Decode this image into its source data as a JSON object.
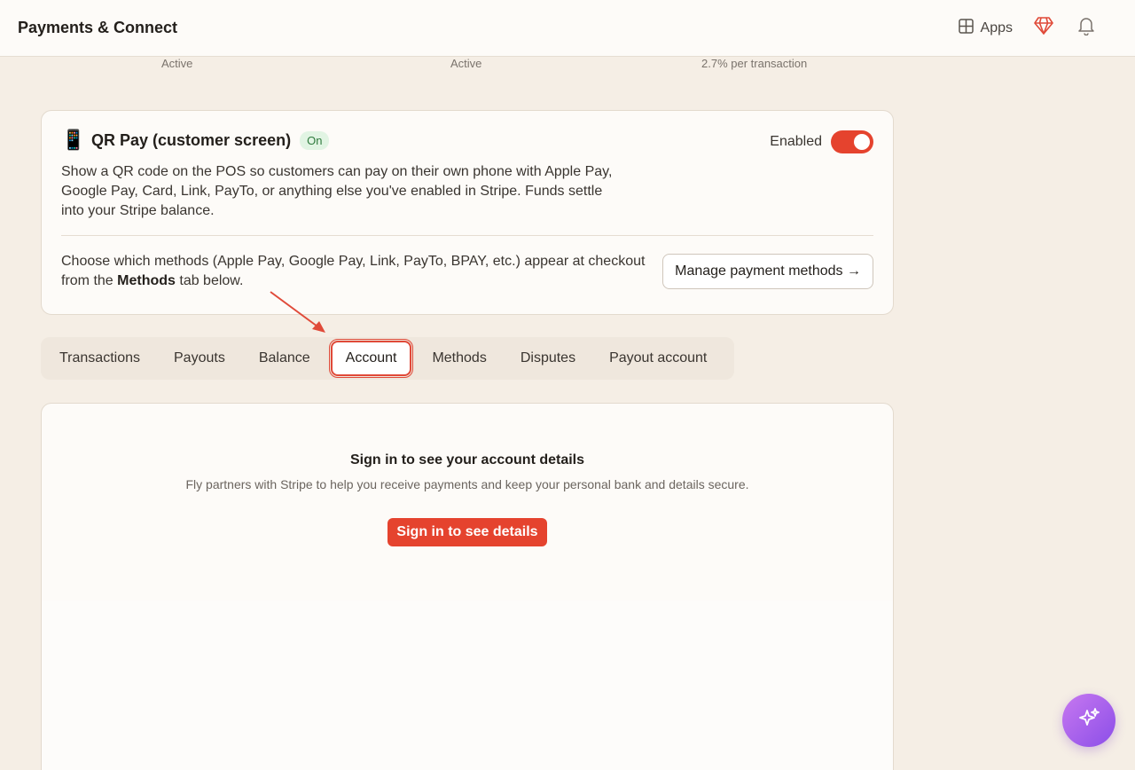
{
  "header": {
    "title": "Payments & Connect",
    "apps_label": "Apps"
  },
  "status_row": {
    "col1": "Active",
    "col2": "Active",
    "col3": "2.7% per transaction"
  },
  "qr_card": {
    "icon": "📱",
    "title": "QR Pay (customer screen)",
    "badge": "On",
    "enabled_label": "Enabled",
    "enabled": true,
    "description": "Show a QR code on the POS so customers can pay on their own phone with Apple Pay, Google Pay, Card, Link, PayTo, or anything else you've enabled in Stripe. Funds settle into your Stripe balance.",
    "footer_prefix": "Choose which methods (Apple Pay, Google Pay, Link, PayTo, BPAY, etc.) appear at checkout from the ",
    "footer_bold": "Methods",
    "footer_suffix": " tab below.",
    "manage_button": "Manage payment methods →"
  },
  "tabs": [
    {
      "label": "Transactions",
      "active": false
    },
    {
      "label": "Payouts",
      "active": false
    },
    {
      "label": "Balance",
      "active": false
    },
    {
      "label": "Account",
      "active": true
    },
    {
      "label": "Methods",
      "active": false
    },
    {
      "label": "Disputes",
      "active": false
    },
    {
      "label": "Payout account",
      "active": false
    }
  ],
  "account_panel": {
    "heading": "Sign in to see your account details",
    "subtext": "Fly partners with Stripe to help you receive payments and keep your personal bank and details secure.",
    "button": "Sign in to see details"
  },
  "colors": {
    "accent": "#e5432e",
    "background": "#f5eee5",
    "badge_bg": "#e1f4e3",
    "fab_gradient_start": "#c778f0",
    "fab_gradient_end": "#8b4ee8"
  },
  "icons": {
    "apps": "grid-icon",
    "gem": "gem-icon",
    "bell": "bell-icon",
    "fab": "sparkles-icon"
  }
}
